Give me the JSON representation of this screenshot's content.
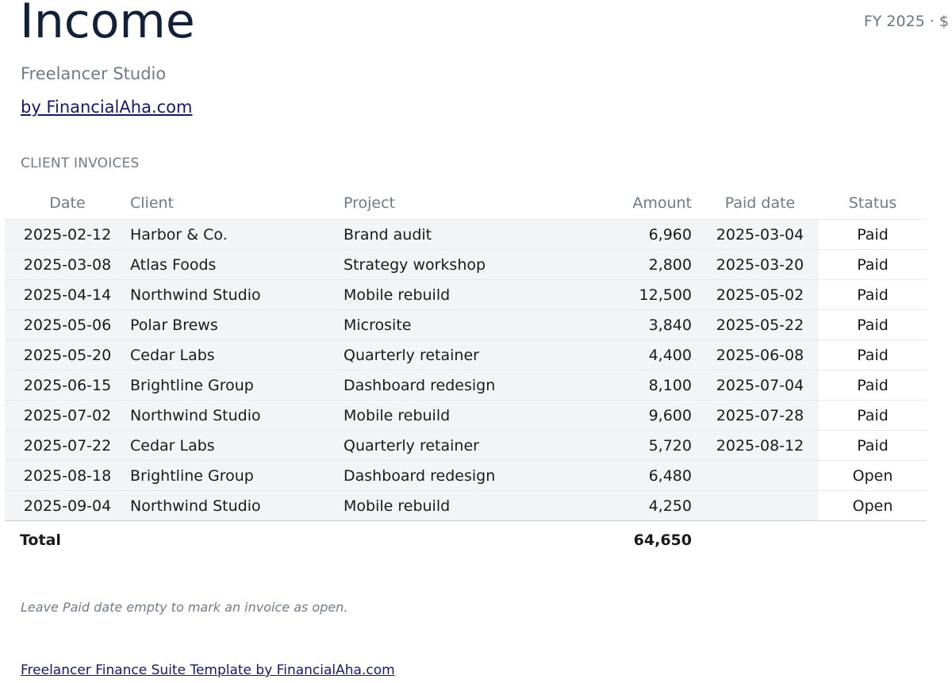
{
  "header": {
    "title": "Income",
    "period": "FY 2025 · $",
    "subtitle": "Freelancer Studio",
    "byline": "by FinancialAha.com"
  },
  "section": {
    "label": "CLIENT INVOICES"
  },
  "table": {
    "columns": {
      "date": "Date",
      "client": "Client",
      "project": "Project",
      "amount": "Amount",
      "paid_date": "Paid date",
      "status": "Status"
    },
    "rows": [
      {
        "date": "2025-02-12",
        "client": "Harbor & Co.",
        "project": "Brand audit",
        "amount": "6,960",
        "paid_date": "2025-03-04",
        "status": "Paid"
      },
      {
        "date": "2025-03-08",
        "client": "Atlas Foods",
        "project": "Strategy workshop",
        "amount": "2,800",
        "paid_date": "2025-03-20",
        "status": "Paid"
      },
      {
        "date": "2025-04-14",
        "client": "Northwind Studio",
        "project": "Mobile rebuild",
        "amount": "12,500",
        "paid_date": "2025-05-02",
        "status": "Paid"
      },
      {
        "date": "2025-05-06",
        "client": "Polar Brews",
        "project": "Microsite",
        "amount": "3,840",
        "paid_date": "2025-05-22",
        "status": "Paid"
      },
      {
        "date": "2025-05-20",
        "client": "Cedar Labs",
        "project": "Quarterly retainer",
        "amount": "4,400",
        "paid_date": "2025-06-08",
        "status": "Paid"
      },
      {
        "date": "2025-06-15",
        "client": "Brightline Group",
        "project": "Dashboard redesign",
        "amount": "8,100",
        "paid_date": "2025-07-04",
        "status": "Paid"
      },
      {
        "date": "2025-07-02",
        "client": "Northwind Studio",
        "project": "Mobile rebuild",
        "amount": "9,600",
        "paid_date": "2025-07-28",
        "status": "Paid"
      },
      {
        "date": "2025-07-22",
        "client": "Cedar Labs",
        "project": "Quarterly retainer",
        "amount": "5,720",
        "paid_date": "2025-08-12",
        "status": "Paid"
      },
      {
        "date": "2025-08-18",
        "client": "Brightline Group",
        "project": "Dashboard redesign",
        "amount": "6,480",
        "paid_date": "",
        "status": "Open"
      },
      {
        "date": "2025-09-04",
        "client": "Northwind Studio",
        "project": "Mobile rebuild",
        "amount": "4,250",
        "paid_date": "",
        "status": "Open"
      }
    ],
    "total": {
      "label": "Total",
      "amount": "64,650"
    }
  },
  "note": "Leave Paid date empty to mark an invoice as open.",
  "footer": {
    "link": "Freelancer Finance Suite Template by FinancialAha.com"
  }
}
